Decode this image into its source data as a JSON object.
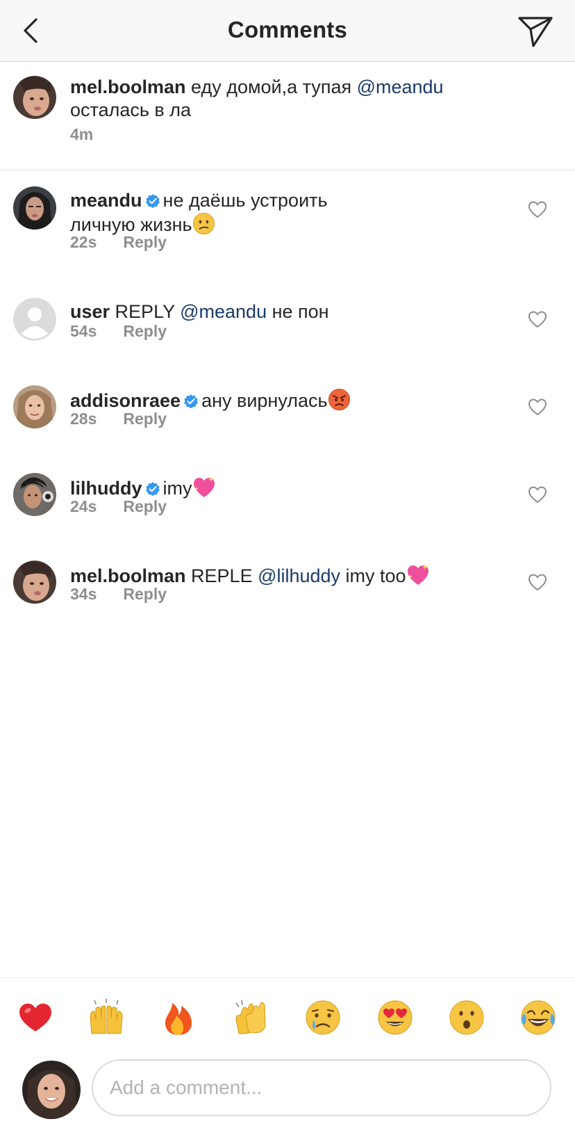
{
  "header": {
    "title": "Comments"
  },
  "caption": {
    "username": "mel.boolman",
    "text_before": " еду домой,а тупая ",
    "mention": "@meandu",
    "text_after": " осталась в ла",
    "time": "4m"
  },
  "comments": [
    {
      "username": "meandu",
      "verified": true,
      "text_line1": "не даёшь устроить",
      "text_line2": "личную жизнь",
      "emoji": "confused-face",
      "time": "22s",
      "reply_label": "Reply"
    },
    {
      "username": "user",
      "verified": false,
      "text_before": " REPLY ",
      "mention": "@meandu",
      "text_after": " не пон",
      "time": "54s",
      "reply_label": "Reply"
    },
    {
      "username": "addisonraee",
      "verified": true,
      "text": "ану вирнулась",
      "emoji": "angry-face",
      "time": "28s",
      "reply_label": "Reply"
    },
    {
      "username": "lilhuddy",
      "verified": true,
      "text": "imy",
      "emoji": "sparkling-heart",
      "time": "24s",
      "reply_label": "Reply"
    },
    {
      "username": "mel.boolman",
      "verified": false,
      "text_before": " REPLE ",
      "mention": "@lilhuddy",
      "text_after": " imy too",
      "emoji": "sparkling-heart",
      "time": "34s",
      "reply_label": "Reply"
    }
  ],
  "emoji_bar": [
    {
      "name": "red-heart",
      "glyph": "❤️"
    },
    {
      "name": "raising-hands",
      "glyph": "🙌"
    },
    {
      "name": "fire",
      "glyph": "🔥"
    },
    {
      "name": "clapping-hands",
      "glyph": "👏"
    },
    {
      "name": "crying-face",
      "glyph": "😢"
    },
    {
      "name": "heart-eyes",
      "glyph": "😍"
    },
    {
      "name": "surprised-face",
      "glyph": "😮"
    },
    {
      "name": "tears-of-joy",
      "glyph": "😂"
    }
  ],
  "input": {
    "placeholder": "Add a comment...",
    "value": ""
  },
  "colors": {
    "mention": "#1b3a6b",
    "verified": "#3897f0",
    "meta": "#8e8e8e",
    "header_bg": "#f8f8f8"
  }
}
